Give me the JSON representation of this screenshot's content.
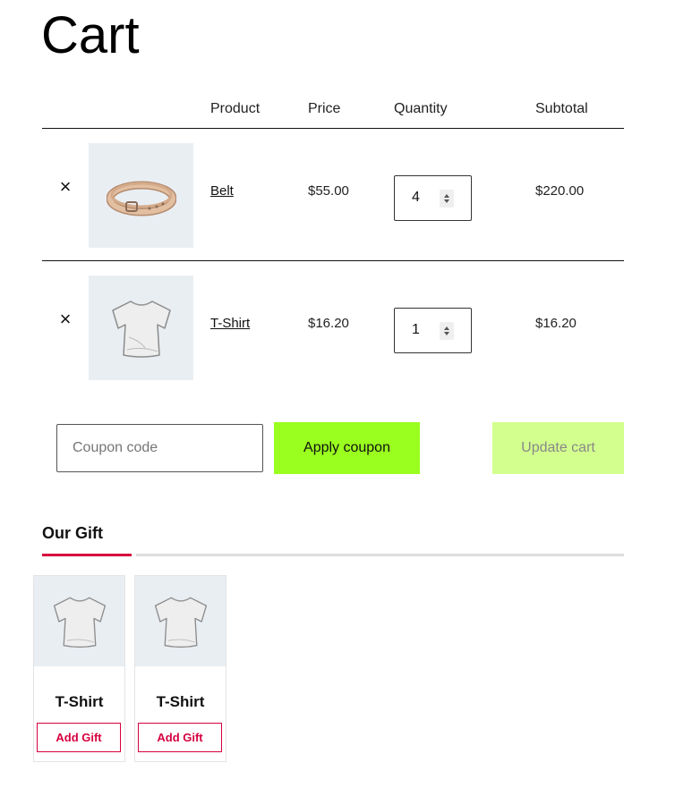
{
  "page": {
    "title": "Cart"
  },
  "table": {
    "headers": {
      "product": "Product",
      "price": "Price",
      "quantity": "Quantity",
      "subtotal": "Subtotal"
    },
    "rows": [
      {
        "remove_symbol": "×",
        "image_icon": "belt-image",
        "product": "Belt",
        "price": "$55.00",
        "quantity": "4",
        "subtotal": "$220.00"
      },
      {
        "remove_symbol": "×",
        "image_icon": "tshirt-image",
        "product": "T-Shirt",
        "price": "$16.20",
        "quantity": "1",
        "subtotal": "$16.20"
      }
    ]
  },
  "actions": {
    "coupon_placeholder": "Coupon code",
    "coupon_value": "",
    "apply_label": "Apply coupon",
    "update_label": "Update cart"
  },
  "gift": {
    "title": "Our Gift",
    "cards": [
      {
        "image_icon": "tshirt-image",
        "name": "T-Shirt",
        "button": "Add Gift"
      },
      {
        "image_icon": "tshirt-image",
        "name": "T-Shirt",
        "button": "Add Gift"
      }
    ]
  },
  "colors": {
    "apply_button": "#9aff1f",
    "update_button": "#d3ff8f",
    "gift_accent": "#d6003e",
    "thumb_bg": "#e9eef3"
  }
}
